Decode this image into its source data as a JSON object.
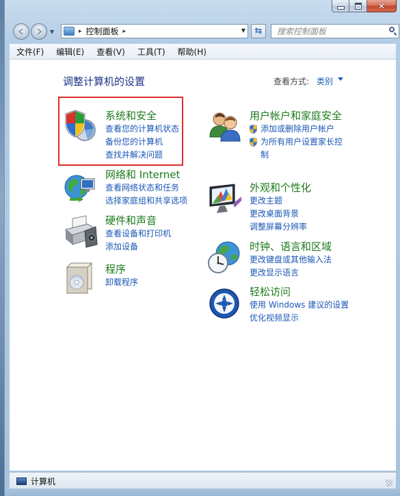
{
  "window": {
    "caption_buttons": {
      "minimize": "−",
      "maximize": "□",
      "close": "✕"
    }
  },
  "navigation": {
    "back_icon": "back-arrow-icon",
    "forward_icon": "forward-arrow-icon",
    "breadcrumb_separator": "▸",
    "address_text": "控制面板",
    "refresh_glyph": "⇆",
    "search_placeholder": "搜索控制面板"
  },
  "menu": {
    "items": [
      {
        "label": "文件(F)"
      },
      {
        "label": "编辑(E)"
      },
      {
        "label": "查看(V)"
      },
      {
        "label": "工具(T)"
      },
      {
        "label": "帮助(H)"
      }
    ]
  },
  "content": {
    "title": "调整计算机的设置",
    "view_by_label": "查看方式:",
    "view_by_value": "类别"
  },
  "categories": {
    "system_security": {
      "title": "系统和安全",
      "links": [
        "查看您的计算机状态",
        "备份您的计算机",
        "查找并解决问题"
      ]
    },
    "network": {
      "title": "网络和 Internet",
      "links": [
        "查看网络状态和任务",
        "选择家庭组和共享选项"
      ]
    },
    "hardware": {
      "title": "硬件和声音",
      "links": [
        "查看设备和打印机",
        "添加设备"
      ]
    },
    "programs": {
      "title": "程序",
      "links": [
        "卸载程序"
      ]
    },
    "user_accounts": {
      "title": "用户帐户和家庭安全",
      "links": [
        "添加或删除用户帐户",
        "为所有用户设置家长控制"
      ]
    },
    "appearance": {
      "title": "外观和个性化",
      "links": [
        "更改主题",
        "更改桌面背景",
        "调整屏幕分辨率"
      ]
    },
    "clock": {
      "title": "时钟、语言和区域",
      "links": [
        "更改键盘或其他输入法",
        "更改显示语言"
      ]
    },
    "ease": {
      "title": "轻松访问",
      "links": [
        "使用 Windows 建议的设置",
        "优化视频显示"
      ]
    }
  },
  "statusbar": {
    "text": "计算机"
  },
  "colors": {
    "category_title": "#1d7a1d",
    "link": "#1a57b5",
    "page_title": "#1e3287",
    "highlight_box": "#e02a2a"
  }
}
